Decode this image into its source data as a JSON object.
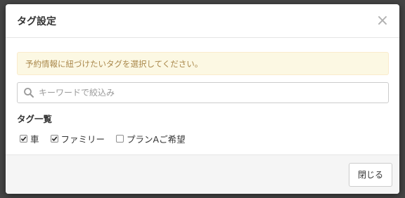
{
  "modal": {
    "title": "タグ設定",
    "close_icon": "×",
    "alert_text": "予約情報に紐づけたいタグを選択してください。",
    "search": {
      "placeholder": "キーワードで絞込み",
      "value": "",
      "icon": "search-icon"
    },
    "tag_list_label": "タグ一覧",
    "tags": [
      {
        "label": "車",
        "checked": true
      },
      {
        "label": "ファミリー",
        "checked": true
      },
      {
        "label": "プランAご希望",
        "checked": false
      }
    ],
    "footer": {
      "close_button_label": "閉じる"
    }
  },
  "colors": {
    "alert_bg": "#fcf8e3",
    "alert_text": "#a9874a",
    "backdrop": "#454545"
  }
}
